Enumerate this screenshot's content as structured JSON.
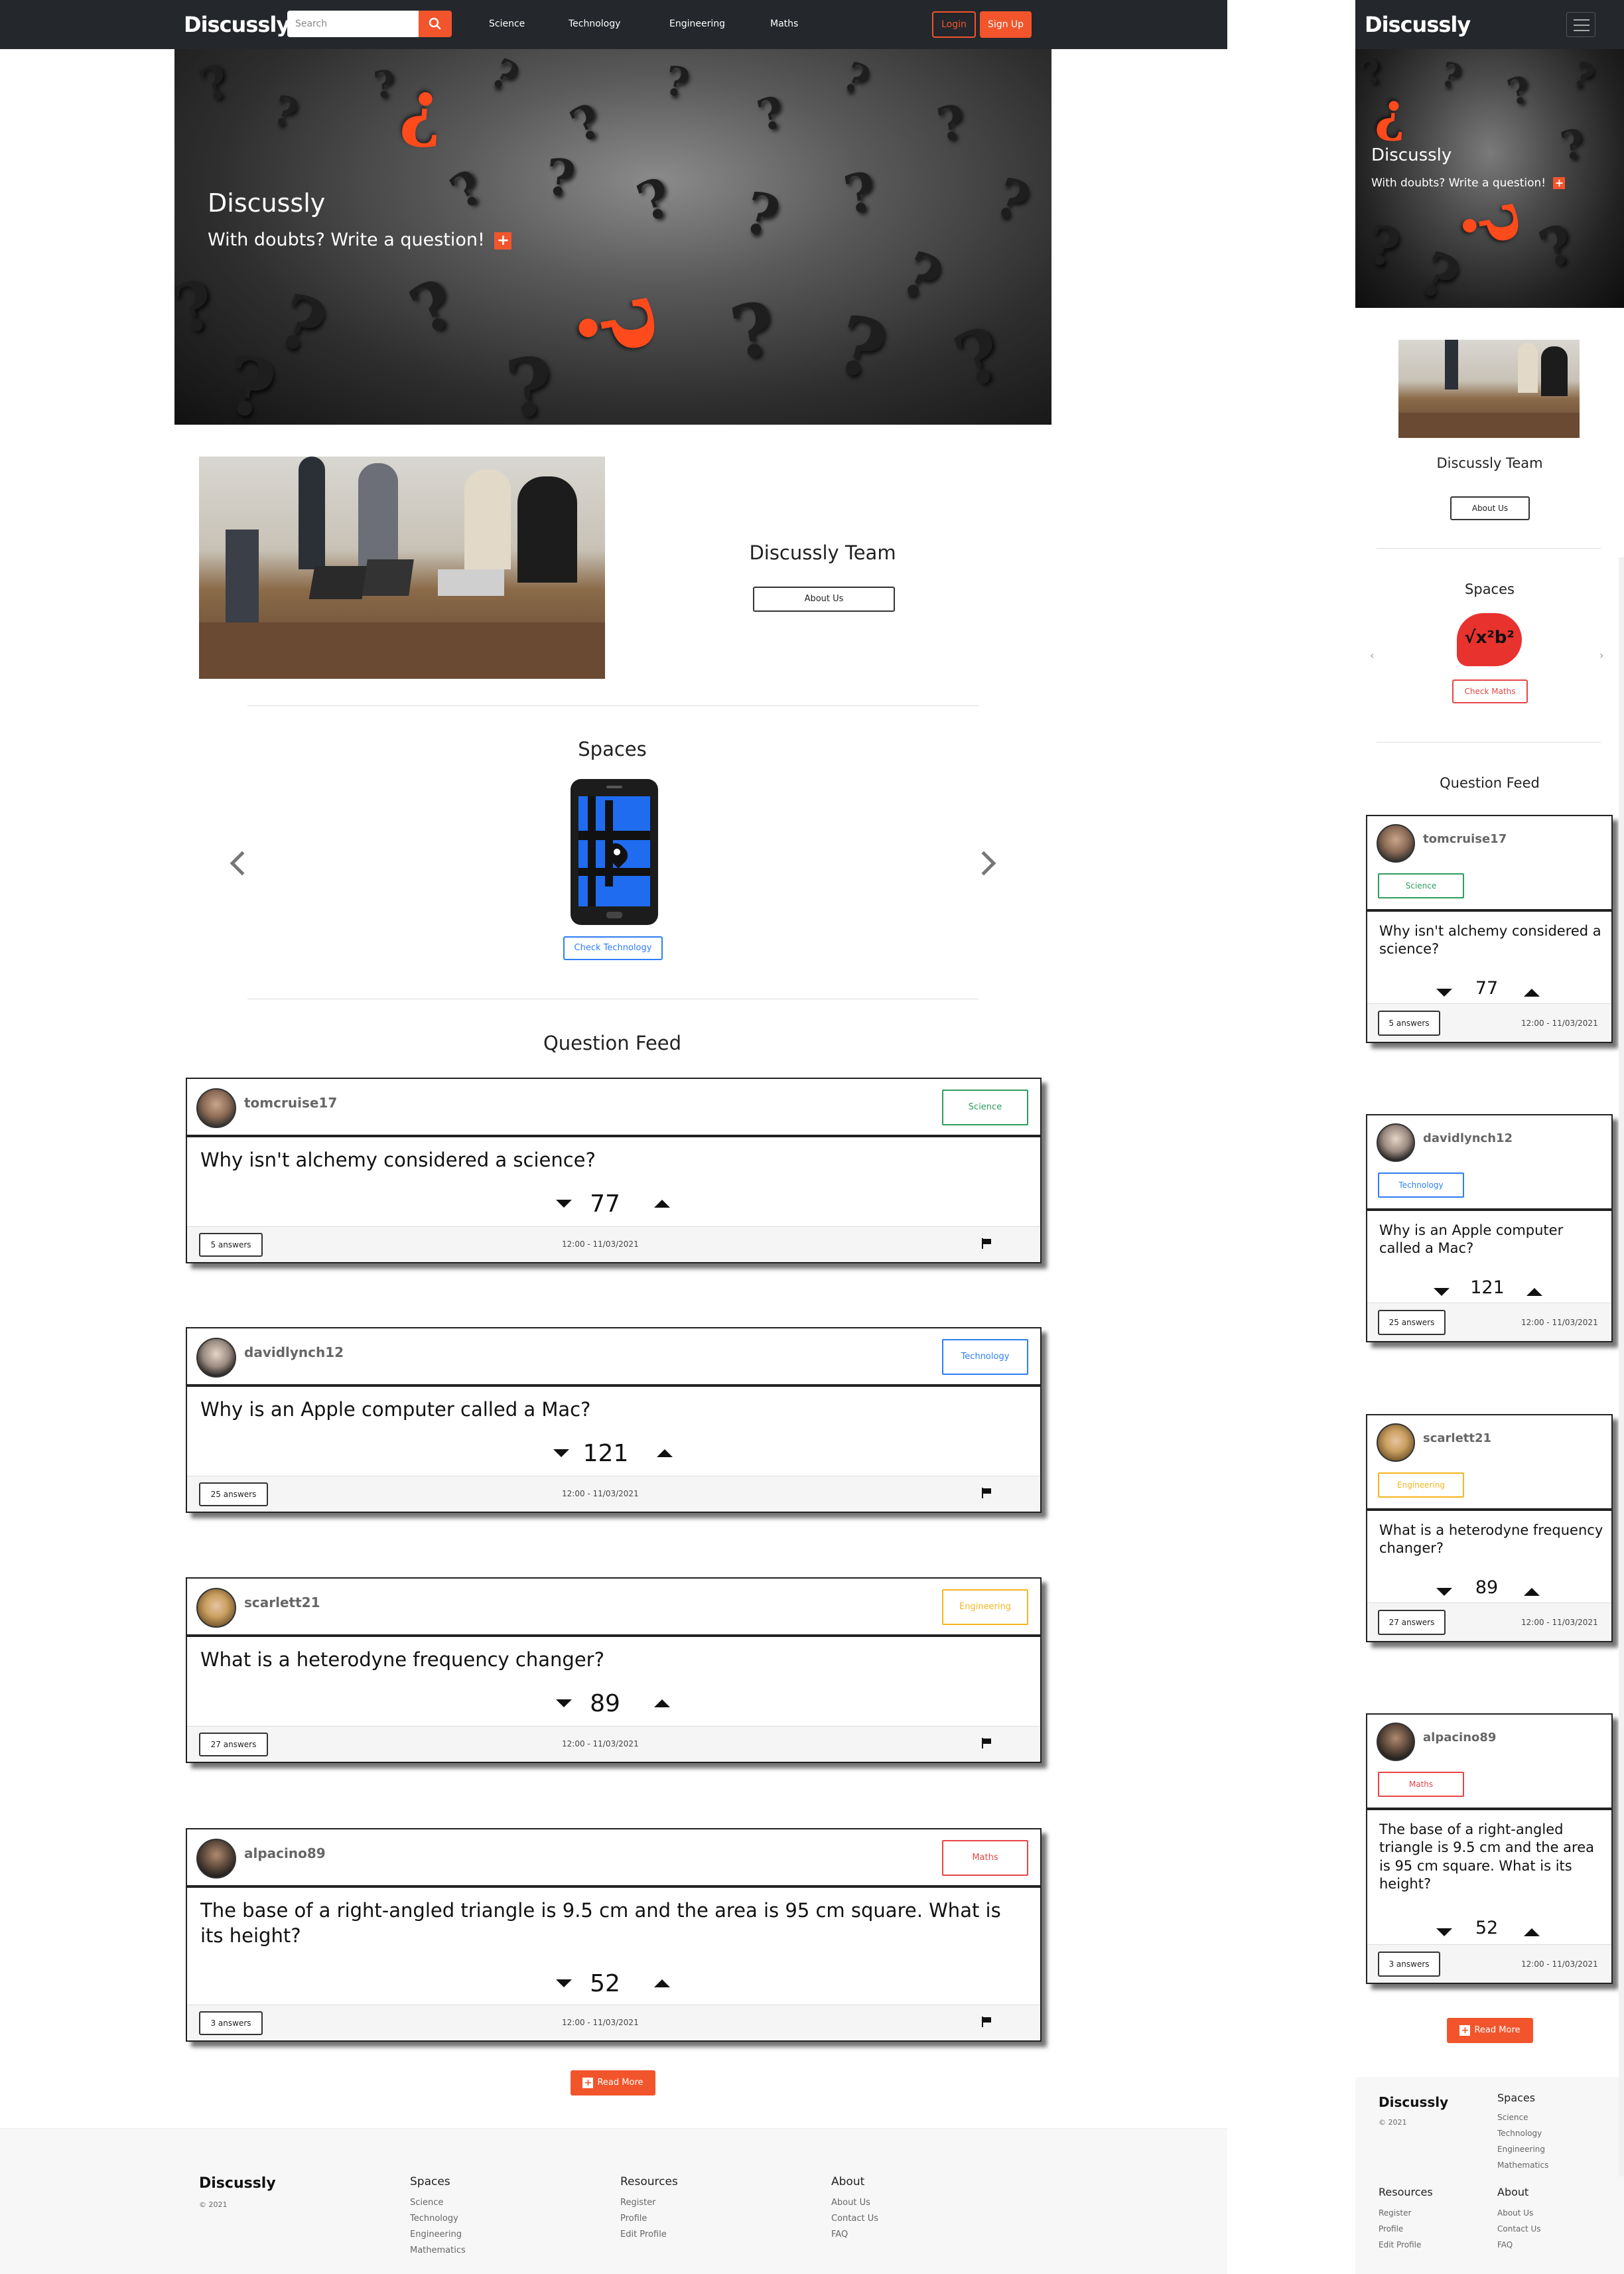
{
  "brand": "Discussly",
  "nav": {
    "search_placeholder": "Search",
    "links": [
      "Science",
      "Technology",
      "Engineering",
      "Maths"
    ],
    "login": "Login",
    "signup": "Sign Up"
  },
  "hero": {
    "title": "Discussly",
    "subtitle": "With doubts? Write a question!",
    "plus": "+"
  },
  "team": {
    "title": "Discussly Team",
    "button": "About Us"
  },
  "spaces": {
    "title": "Spaces",
    "desktop_button": "Check Technology",
    "mobile_button": "Check Maths",
    "maths_symbol": "√x²b²"
  },
  "feed": {
    "title": "Question Feed",
    "questions": [
      {
        "user": "tomcruise17",
        "tag": "Science",
        "tag_color": "#2e9d5b",
        "question": "Why isn't alchemy considered a science?",
        "votes": "77",
        "answers": "5 answers",
        "time": "12:00 - 11/03/2021"
      },
      {
        "user": "davidlynch12",
        "tag": "Technology",
        "tag_color": "#2e7ef7",
        "question": "Why is an Apple computer called a Mac?",
        "votes": "121",
        "answers": "25 answers",
        "time": "12:00 - 11/03/2021"
      },
      {
        "user": "scarlett21",
        "tag": "Engineering",
        "tag_color": "#f5b61e",
        "question": "What is a heterodyne frequency changer?",
        "votes": "89",
        "answers": "27 answers",
        "time": "12:00 - 11/03/2021"
      },
      {
        "user": "alpacino89",
        "tag": "Maths",
        "tag_color": "#e84545",
        "question": "The base of a right-angled triangle is 9.5 cm and the area is 95 cm square. What is its height?",
        "votes": "52",
        "answers": "3 answers",
        "time": "12:00 - 11/03/2021"
      }
    ],
    "read_more": "Read More"
  },
  "footer": {
    "brand": "Discussly",
    "copyright": "© 2021",
    "spaces": {
      "title": "Spaces",
      "links": [
        "Science",
        "Technology",
        "Engineering",
        "Mathematics"
      ]
    },
    "resources": {
      "title": "Resources",
      "links": [
        "Register",
        "Profile",
        "Edit Profile"
      ]
    },
    "about": {
      "title": "About",
      "links": [
        "About Us",
        "Contact Us",
        "FAQ"
      ]
    }
  },
  "colors": {
    "accent": "#f2552c",
    "navbar": "#24272b"
  }
}
